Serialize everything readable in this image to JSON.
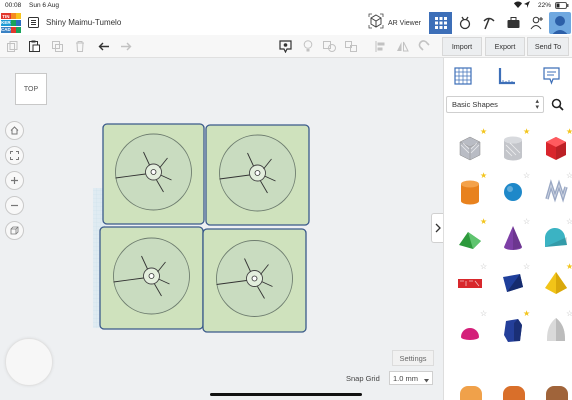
{
  "status_bar": {
    "time": "00:08",
    "date": "Sun 6 Aug",
    "battery": "22%"
  },
  "header": {
    "logo_letters": [
      "TIN",
      "KER",
      "CAD"
    ],
    "design_name": "Shiny Maimu-Tumelo",
    "ar_viewer_label": "AR Viewer",
    "icons": [
      "menu-icon",
      "ar-cube-icon",
      "grid-view-icon",
      "gallery-icon",
      "pickaxe-icon",
      "suitcase-icon",
      "add-user-icon",
      "avatar"
    ]
  },
  "toolbar": {
    "import_label": "Import",
    "export_label": "Export",
    "send_to_label": "Send To",
    "icons": [
      "copy-icon",
      "paste-icon",
      "duplicate-icon",
      "delete-icon",
      "undo-icon",
      "redo-icon",
      "note-icon",
      "light-icon",
      "group-icon",
      "ungroup-icon",
      "align-icon",
      "mirror-icon",
      "magnet-icon"
    ]
  },
  "viewport": {
    "view_cube_label": "TOP",
    "settings_label": "Settings",
    "snap_grid_label": "Snap Grid",
    "snap_grid_value": "1.0 mm",
    "nav_icons": [
      "home-icon",
      "fit-icon",
      "zoom-in-icon",
      "zoom-out-icon",
      "ortho-icon"
    ]
  },
  "panel": {
    "category_label": "Basic Shapes",
    "tab_icons": [
      "workplane-grid-icon",
      "ruler-icon",
      "note-icon"
    ],
    "shapes": [
      {
        "name": "Box Hole",
        "color": "#b9bcc4",
        "star": true
      },
      {
        "name": "Cylinder Hole",
        "color": "#c3c5ca",
        "star": true
      },
      {
        "name": "Box",
        "color": "#d9252c",
        "star": true
      },
      {
        "name": "Cylinder",
        "color": "#e8821e",
        "star": true
      },
      {
        "name": "Sphere",
        "color": "#1e88c9",
        "star": false
      },
      {
        "name": "Scribble",
        "color": "#9aa8c4",
        "star": false
      },
      {
        "name": "Roof",
        "color": "#2d9a3c",
        "star": true
      },
      {
        "name": "Cone",
        "color": "#7d3fa6",
        "star": false
      },
      {
        "name": "Round Roof",
        "color": "#3bb3c3",
        "star": false
      },
      {
        "name": "Text",
        "color": "#d8282c",
        "star": false
      },
      {
        "name": "Half Sphere",
        "color": "#1f3f9b",
        "star": false
      },
      {
        "name": "Pyramid",
        "color": "#f2c418",
        "star": true
      },
      {
        "name": "Paraboloid",
        "color": "#d4207a",
        "star": false
      },
      {
        "name": "Polygon",
        "color": "#243f9a",
        "star": true
      },
      {
        "name": "Ring",
        "color": "#d9d9d9",
        "star": false
      }
    ]
  },
  "colors": {
    "accent": "#3d6fb8",
    "shape_green": "#cfe2bd",
    "shape_stroke": "#3a5a8a",
    "star": "#f3c51c"
  }
}
